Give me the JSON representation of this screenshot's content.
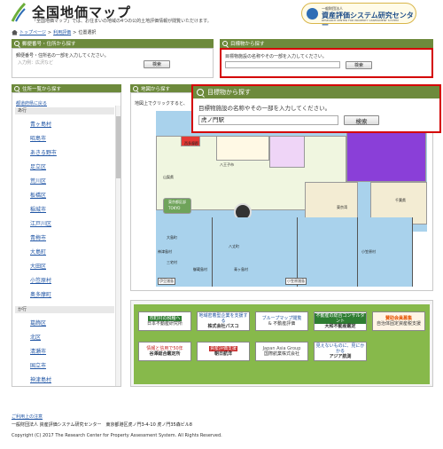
{
  "header": {
    "title": "全国地価マップ",
    "subtitle": "「全国地価マップ」では、お住まいの地域の4つの公的土地評価情報が閲覧いただけます。",
    "org_small": "一般財団法人",
    "org_name": "資産評価システム研究センター",
    "org_en": "RESEARCH CENTER FOR PROPERTY ASSESSMENT SYSTEM"
  },
  "breadcrumb": {
    "top": "トップページ",
    "sep": ">",
    "link": "利用評価",
    "current": "位置選択"
  },
  "postal": {
    "title": "郵便番号・住所から探す",
    "desc": "郵便番号・住所名の一部を入力してください。",
    "placeholder": "入力例：広沢など",
    "button": "検索"
  },
  "landmark_small": {
    "title": "目標物から探す",
    "desc": "目標物施設の名称やその一部を入力してください。",
    "button": "検索"
  },
  "address_list": {
    "title": "住所一覧から探す",
    "back": "都道府県に戻る",
    "group1": "あ行",
    "items1": [
      "青ヶ島村",
      "昭島市",
      "あきる野市",
      "足立区",
      "荒川区",
      "板橋区",
      "稲城市",
      "江戸川区",
      "青梅市",
      "大島町",
      "大田区",
      "小笠原村",
      "奥多摩町"
    ],
    "group2": "か行",
    "items2": [
      "葛飾区",
      "北区",
      "清瀬市",
      "国立市",
      "神津島村"
    ]
  },
  "map": {
    "title": "地図から探す",
    "hint": "地図上でクリックすると、",
    "labels": [
      "西多摩郡",
      "八王子市",
      "山梨県",
      "神奈川県",
      "東京湾",
      "千葉県",
      "東京都区部",
      "TOKYO"
    ],
    "islands": [
      "伊豆諸島",
      "小笠原諸島",
      "大島町",
      "三宅村",
      "八丈町",
      "青ヶ島村",
      "御蔵島村",
      "神津島村",
      "小笠原村"
    ]
  },
  "banners": [
    {
      "top": "市町村の税種へ",
      "bottom": "日本不動産研究所"
    },
    {
      "top": "地域密着型企業を支援する",
      "bottom": "株式会社パスコ"
    },
    {
      "top": "ブループマップ閲覧",
      "bottom": "& 不動産評価"
    },
    {
      "top": "不動産の総合コンサルタント",
      "bottom": "大和不動産鑑定"
    },
    {
      "top": "賛助会員募集",
      "bottom": "自治体固定資産税支援"
    },
    {
      "top": "情報と信用で50年",
      "bottom": "谷澤総合鑑定所"
    },
    {
      "top": "資産評価支援",
      "bottom": "朝日航洋"
    },
    {
      "top": "Japan Asia Group",
      "bottom": "国際航業株式会社"
    },
    {
      "top": "見えないものに、見にかかる",
      "bottom": "アジア航測"
    }
  ],
  "modal": {
    "title": "目標物から探す",
    "desc": "目標物施設の名称やその一部を入力してください。",
    "value": "虎ノ門駅",
    "button": "検索"
  },
  "footer": {
    "note": "ご利用上の注意",
    "address": "一般財団法人 資産評価システム研究センター　東京都港区虎ノ門3-4-10 虎ノ門35森ビル8",
    "copyright": "Copyright (C) 2017 The Research Center for Property Assessment System. All Rights Reserved."
  },
  "colors": {
    "panel_header": "#6d8a3c",
    "link": "#2156a5",
    "modal_border": "#d40000",
    "banner_bg": "#87b94b"
  }
}
